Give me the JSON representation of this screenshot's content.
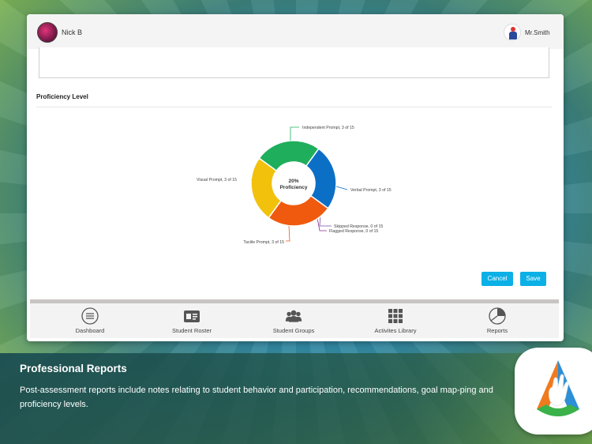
{
  "header": {
    "user_name": "Nick B",
    "teacher_name": "Mr.Smith"
  },
  "section": {
    "title": "Proficiency Level"
  },
  "chart_data": {
    "type": "pie",
    "center_value": "20%",
    "center_label": "Proficiency",
    "slices": [
      {
        "label": "Independent Prompt, 3 of 15",
        "value": 3,
        "color": "#1fae5b"
      },
      {
        "label": "Verbal Prompt, 3 of 15",
        "value": 3,
        "color": "#0c6fc6"
      },
      {
        "label": "Skipped Response, 0 of 15",
        "value": 0,
        "color": "#7a4fa8"
      },
      {
        "label": "Flagged Response, 0 of 15",
        "value": 0,
        "color": "#8a2f8f"
      },
      {
        "label": "Tactile Prompt, 3 of 15",
        "value": 3,
        "color": "#f05a0e"
      },
      {
        "label": "Visual Prompt, 3 of 15",
        "value": 3,
        "color": "#f2c10c"
      }
    ]
  },
  "actions": {
    "cancel_label": "Cancel",
    "save_label": "Save"
  },
  "tabs": [
    {
      "label": "Dashboard",
      "icon": "menu-icon"
    },
    {
      "label": "Student Roster",
      "icon": "id-card-icon"
    },
    {
      "label": "Student Groups",
      "icon": "group-icon"
    },
    {
      "label": "Activites Library",
      "icon": "grid-icon"
    },
    {
      "label": "Reports",
      "icon": "pie-chart-icon"
    }
  ],
  "footer": {
    "title": "Professional Reports",
    "text": "Post-assessment reports include notes relating to student behavior and participation, recommendations, goal map-ping and proficiency levels."
  },
  "colors": {
    "accent": "#0ab0e6"
  }
}
